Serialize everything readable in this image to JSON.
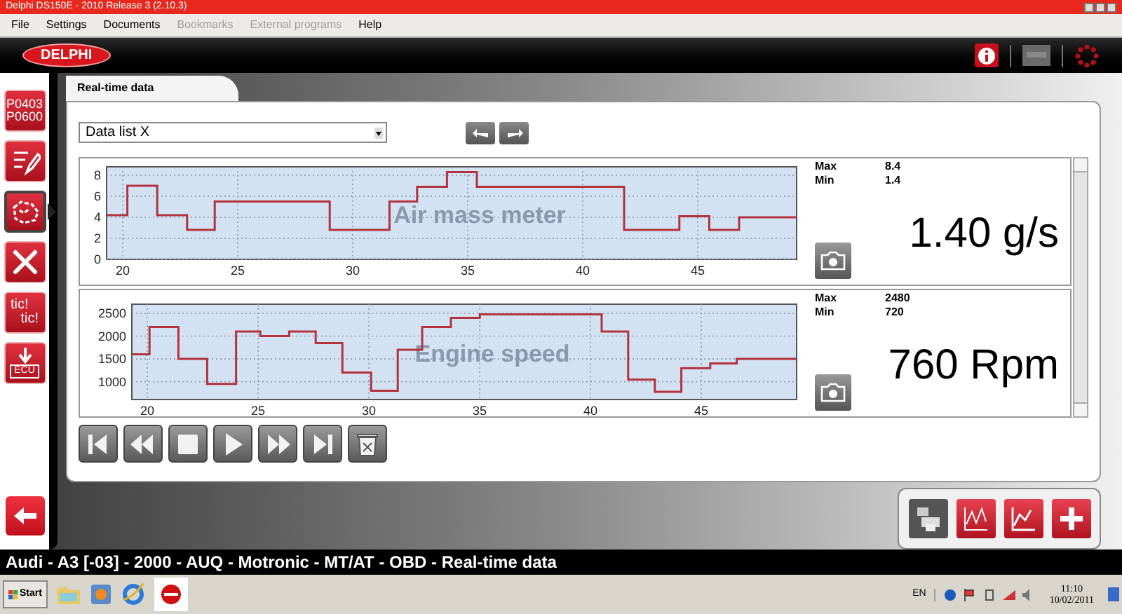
{
  "window": {
    "title": "Delphi DS150E - 2010 Release 3 (2.10.3)"
  },
  "menu": [
    {
      "label": "File",
      "disabled": false
    },
    {
      "label": "Settings",
      "disabled": false
    },
    {
      "label": "Documents",
      "disabled": false
    },
    {
      "label": "Bookmarks",
      "disabled": true
    },
    {
      "label": "External programs",
      "disabled": true
    },
    {
      "label": "Help",
      "disabled": false
    }
  ],
  "header": {
    "logo": "DELPHI"
  },
  "sidebar": {
    "items": [
      {
        "kind": "fault-codes",
        "lines": [
          "P0403",
          "P0600"
        ],
        "selected": false
      },
      {
        "kind": "edit-codes",
        "selected": false
      },
      {
        "kind": "realtime",
        "selected": true
      },
      {
        "kind": "tools",
        "selected": false
      },
      {
        "kind": "activation",
        "lines": [
          "tic!",
          "tic!"
        ],
        "selected": false
      },
      {
        "kind": "ecu",
        "lines": [
          "ECU"
        ],
        "selected": false
      }
    ]
  },
  "tab": {
    "label": "Real-time data"
  },
  "data_list": {
    "value": "Data list X"
  },
  "parameters": [
    {
      "max_label": "Max",
      "max": "8.4",
      "min_label": "Min",
      "min": "1.4",
      "reading": "1.40 g/s",
      "chart_data": {
        "type": "line",
        "grid": true,
        "xlim": [
          19.3,
          49.3
        ],
        "ylim": [
          0,
          8.8
        ],
        "xticks": [
          20,
          25,
          30,
          35,
          40,
          45
        ],
        "yticks": [
          0,
          2,
          4,
          6,
          8
        ],
        "x": [
          19.3,
          20.2,
          20.2,
          21.5,
          21.5,
          22.8,
          22.8,
          24.0,
          24.0,
          29.0,
          29.0,
          31.6,
          31.6,
          32.8,
          32.8,
          34.1,
          34.1,
          35.4,
          35.4,
          41.8,
          41.8,
          44.2,
          44.2,
          45.5,
          45.5,
          46.8,
          46.8,
          49.3
        ],
        "series": [
          {
            "name": "Air mass meter",
            "color": "#b3323c",
            "values": [
              4.2,
              4.2,
              7.0,
              7.0,
              4.2,
              4.2,
              2.8,
              2.8,
              5.5,
              5.5,
              2.8,
              2.8,
              5.5,
              5.5,
              6.9,
              6.9,
              8.3,
              8.3,
              6.9,
              6.9,
              2.8,
              2.8,
              4.1,
              4.1,
              2.8,
              2.8,
              4.0,
              4.0
            ]
          }
        ]
      }
    },
    {
      "max_label": "Max",
      "max": "2480",
      "min_label": "Min",
      "min": "720",
      "reading": "760 Rpm",
      "chart_data": {
        "type": "line",
        "grid": true,
        "xlim": [
          19.3,
          49.3
        ],
        "ylim": [
          610,
          2700
        ],
        "xticks": [
          20,
          25,
          30,
          35,
          40,
          45
        ],
        "yticks": [
          1000,
          1500,
          2000,
          2500
        ],
        "x": [
          19.3,
          20.1,
          20.1,
          21.4,
          21.4,
          22.7,
          22.7,
          24.0,
          24.0,
          25.1,
          25.1,
          26.4,
          26.4,
          27.6,
          27.6,
          28.8,
          28.8,
          30.1,
          30.1,
          31.3,
          31.3,
          32.4,
          32.4,
          33.7,
          33.7,
          35.0,
          35.0,
          40.5,
          40.5,
          41.7,
          41.7,
          42.9,
          42.9,
          44.1,
          44.1,
          45.4,
          45.4,
          46.6,
          46.6,
          49.3
        ],
        "series": [
          {
            "name": "Engine speed",
            "color": "#b3323c",
            "values": [
              1600,
              1600,
              2200,
              2200,
              1500,
              1500,
              950,
              950,
              2100,
              2100,
              2000,
              2000,
              2100,
              2100,
              1850,
              1850,
              1200,
              1200,
              800,
              800,
              1700,
              1700,
              2200,
              2200,
              2400,
              2400,
              2480,
              2480,
              2100,
              2100,
              1050,
              1050,
              780,
              780,
              1300,
              1300,
              1400,
              1400,
              1500,
              1500
            ]
          }
        ]
      }
    }
  ],
  "status_bar": "Audi - A3 [-03] - 2000 - AUQ - Motronic - MT/AT - OBD - Real-time data",
  "taskbar": {
    "start": "Start",
    "language": "EN",
    "time": "11:10",
    "date": "10/02/2011"
  }
}
